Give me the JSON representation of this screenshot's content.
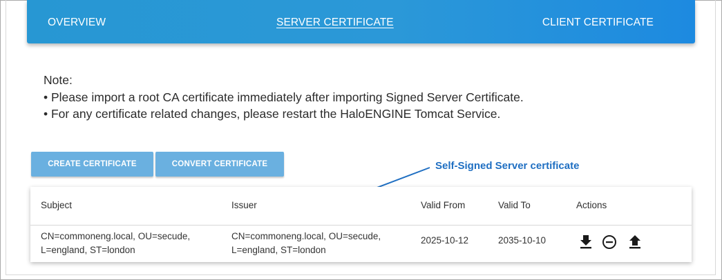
{
  "tabs": [
    {
      "label": "OVERVIEW",
      "active": false
    },
    {
      "label": "SERVER CERTIFICATE",
      "active": true
    },
    {
      "label": "CLIENT CERTIFICATE",
      "active": false
    }
  ],
  "note": {
    "heading": "Note:",
    "lines": [
      "• Please import a root CA certificate immediately after importing Signed Server Certificate.",
      "• For any certificate related changes, please restart the HaloENGINE Tomcat Service."
    ]
  },
  "buttons": {
    "create": "CREATE CERTIFICATE",
    "convert": "CONVERT CERTIFICATE"
  },
  "annotation": "Self-Signed Server certificate",
  "table": {
    "headers": [
      "Subject",
      "Issuer",
      "Valid From",
      "Valid To",
      "Actions"
    ],
    "rows": [
      {
        "subject": "CN=commoneng.local, OU=secude, L=england, ST=london",
        "issuer": "CN=commoneng.local, OU=secude, L=england, ST=london",
        "valid_from": "2025-10-12",
        "valid_to": "2035-10-10",
        "actions": [
          "download-icon",
          "remove-circle-icon",
          "upload-icon"
        ]
      }
    ]
  },
  "colors": {
    "tab_bar": "#2797d3",
    "button": "#6ab0e0",
    "annotation": "#1f6fc2"
  }
}
